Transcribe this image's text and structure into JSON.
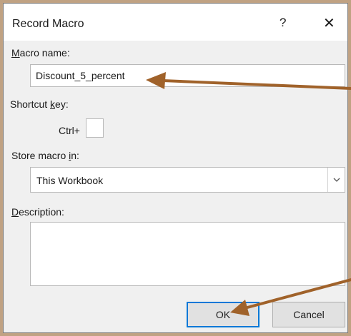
{
  "dialog": {
    "title": "Record Macro",
    "help_label": "?",
    "close_label": "✕"
  },
  "macro_name": {
    "label_key": "M",
    "label_rest": "acro name:",
    "value": "Discount_5_percent"
  },
  "shortcut": {
    "label_pre": "Shortcut ",
    "label_key": "k",
    "label_post": "ey:",
    "ctrl_label": "Ctrl+",
    "value": ""
  },
  "store": {
    "label_pre": "Store macro ",
    "label_key": "i",
    "label_post": "n:",
    "selected": "This Workbook"
  },
  "description": {
    "label_key": "D",
    "label_rest": "escription:",
    "value": ""
  },
  "buttons": {
    "ok": "OK",
    "cancel": "Cancel"
  },
  "colors": {
    "annotation_arrow": "#a0622a",
    "primary_border": "#0078d7"
  }
}
